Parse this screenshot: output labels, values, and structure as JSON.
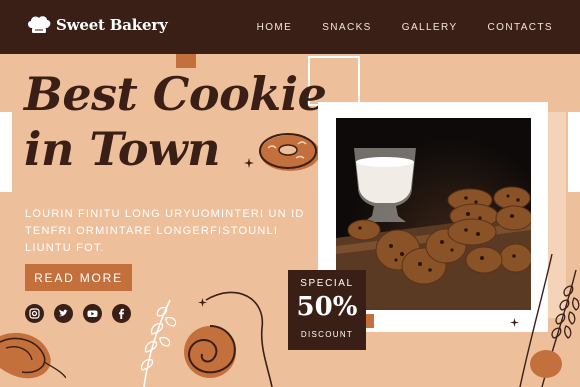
{
  "brand": {
    "name": "Sweet Bakery",
    "icon": "chef-hat-icon"
  },
  "nav": {
    "items": [
      {
        "label": "HOME"
      },
      {
        "label": "SNACKS"
      },
      {
        "label": "GALLERY"
      },
      {
        "label": "CONTACTS"
      }
    ]
  },
  "hero": {
    "title_line1": "Best Cookie",
    "title_line2": "in Town",
    "description": "LOURIN FINITU LONG URYUOMINTERI UN ID TENFRI ORMINTARE LONGERFISTOUNLI LIUNTU FOT.",
    "cta_label": "READ MORE"
  },
  "social": [
    {
      "icon": "instagram-icon"
    },
    {
      "icon": "twitter-icon"
    },
    {
      "icon": "youtube-icon"
    },
    {
      "icon": "facebook-icon"
    }
  ],
  "promo": {
    "label": "SPECIAL",
    "value": "50%",
    "sub": "DISCOUNT"
  },
  "colors": {
    "dark_brown": "#3a1f17",
    "peach": "#edbf9b",
    "accent": "#c4703c",
    "light_peach": "#f4d3b8"
  }
}
